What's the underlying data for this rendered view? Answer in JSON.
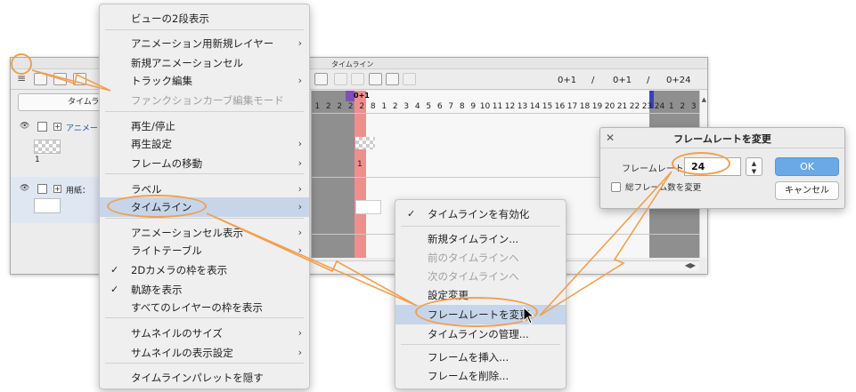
{
  "window": {
    "title": "タイムライン",
    "tab_label": "タイムライ",
    "counters": {
      "a": "0+1",
      "sep1": "/",
      "b": "0+1",
      "sep2": "/",
      "c": "0+24"
    },
    "playhead": "0+1",
    "frame_numbers": [
      "1",
      "2",
      "2",
      "2",
      "2",
      "8",
      "1",
      "2",
      "3",
      "4",
      "5",
      "6",
      "7",
      "8",
      "9",
      "10",
      "11",
      "12",
      "13",
      "14",
      "15",
      "16",
      "17",
      "18",
      "19",
      "20",
      "21",
      "22",
      "23",
      "24",
      "1",
      "2",
      "3",
      "4"
    ],
    "layers": [
      {
        "name": "アニメー",
        "cel_label": "1"
      },
      {
        "name": "用紙：",
        "cel_label": ""
      }
    ],
    "grid_cel_label": "1"
  },
  "menu": {
    "items": [
      {
        "label": "ビューの2段表示",
        "submenu": false,
        "checked": false,
        "disabled": false
      },
      {
        "label": "アニメーション用新規レイヤー",
        "submenu": true,
        "checked": false,
        "disabled": false
      },
      {
        "label": "新規アニメーションセル",
        "submenu": false,
        "checked": false,
        "disabled": false
      },
      {
        "label": "トラック編集",
        "submenu": true,
        "checked": false,
        "disabled": false
      },
      {
        "label": "ファンクションカーブ編集モード",
        "submenu": false,
        "checked": false,
        "disabled": true
      },
      {
        "label": "再生/停止",
        "submenu": false,
        "checked": false,
        "disabled": false
      },
      {
        "label": "再生設定",
        "submenu": true,
        "checked": false,
        "disabled": false
      },
      {
        "label": "フレームの移動",
        "submenu": true,
        "checked": false,
        "disabled": false
      },
      {
        "label": "ラベル",
        "submenu": true,
        "checked": false,
        "disabled": false
      },
      {
        "label": "タイムライン",
        "submenu": true,
        "checked": false,
        "disabled": false,
        "highlighted": true
      },
      {
        "label": "アニメーションセル表示",
        "submenu": true,
        "checked": false,
        "disabled": false
      },
      {
        "label": "ライトテーブル",
        "submenu": true,
        "checked": false,
        "disabled": false
      },
      {
        "label": "2Dカメラの枠を表示",
        "submenu": false,
        "checked": true,
        "disabled": false
      },
      {
        "label": "軌跡を表示",
        "submenu": false,
        "checked": true,
        "disabled": false
      },
      {
        "label": "すべてのレイヤーの枠を表示",
        "submenu": false,
        "checked": false,
        "disabled": false
      },
      {
        "label": "サムネイルのサイズ",
        "submenu": true,
        "checked": false,
        "disabled": false
      },
      {
        "label": "サムネイルの表示設定",
        "submenu": true,
        "checked": false,
        "disabled": false
      },
      {
        "label": "タイムラインパレットを隠す",
        "submenu": false,
        "checked": false,
        "disabled": false
      }
    ]
  },
  "submenu": {
    "items": [
      {
        "label": "タイムラインを有効化",
        "checked": true,
        "disabled": false
      },
      {
        "label": "新規タイムライン...",
        "checked": false,
        "disabled": false
      },
      {
        "label": "前のタイムラインへ",
        "checked": false,
        "disabled": true
      },
      {
        "label": "次のタイムラインへ",
        "checked": false,
        "disabled": true
      },
      {
        "label": "設定変更",
        "checked": false,
        "disabled": false
      },
      {
        "label": "フレームレートを変更",
        "checked": false,
        "disabled": false,
        "highlighted": true
      },
      {
        "label": "タイムラインの管理...",
        "checked": false,
        "disabled": false
      },
      {
        "label": "フレームを挿入...",
        "checked": false,
        "disabled": false
      },
      {
        "label": "フレームを削除...",
        "checked": false,
        "disabled": false
      }
    ]
  },
  "dialog": {
    "title": "フレームレートを変更",
    "close": "✕",
    "framerate_label": "フレームレート：",
    "framerate_value": "24",
    "stepper": "▲▼",
    "total_frames_label": "総フレーム数を変更",
    "total_frames_checked": false,
    "ok_label": "OK",
    "cancel_label": "キャンセル"
  },
  "colors": {
    "callout": "#f0a050",
    "menu_highlight": "#c6d5ea",
    "ok_button": "#6aa9e5",
    "playhead_red": "#ef8e8e",
    "timeline_gray": "#8f8f8f"
  }
}
